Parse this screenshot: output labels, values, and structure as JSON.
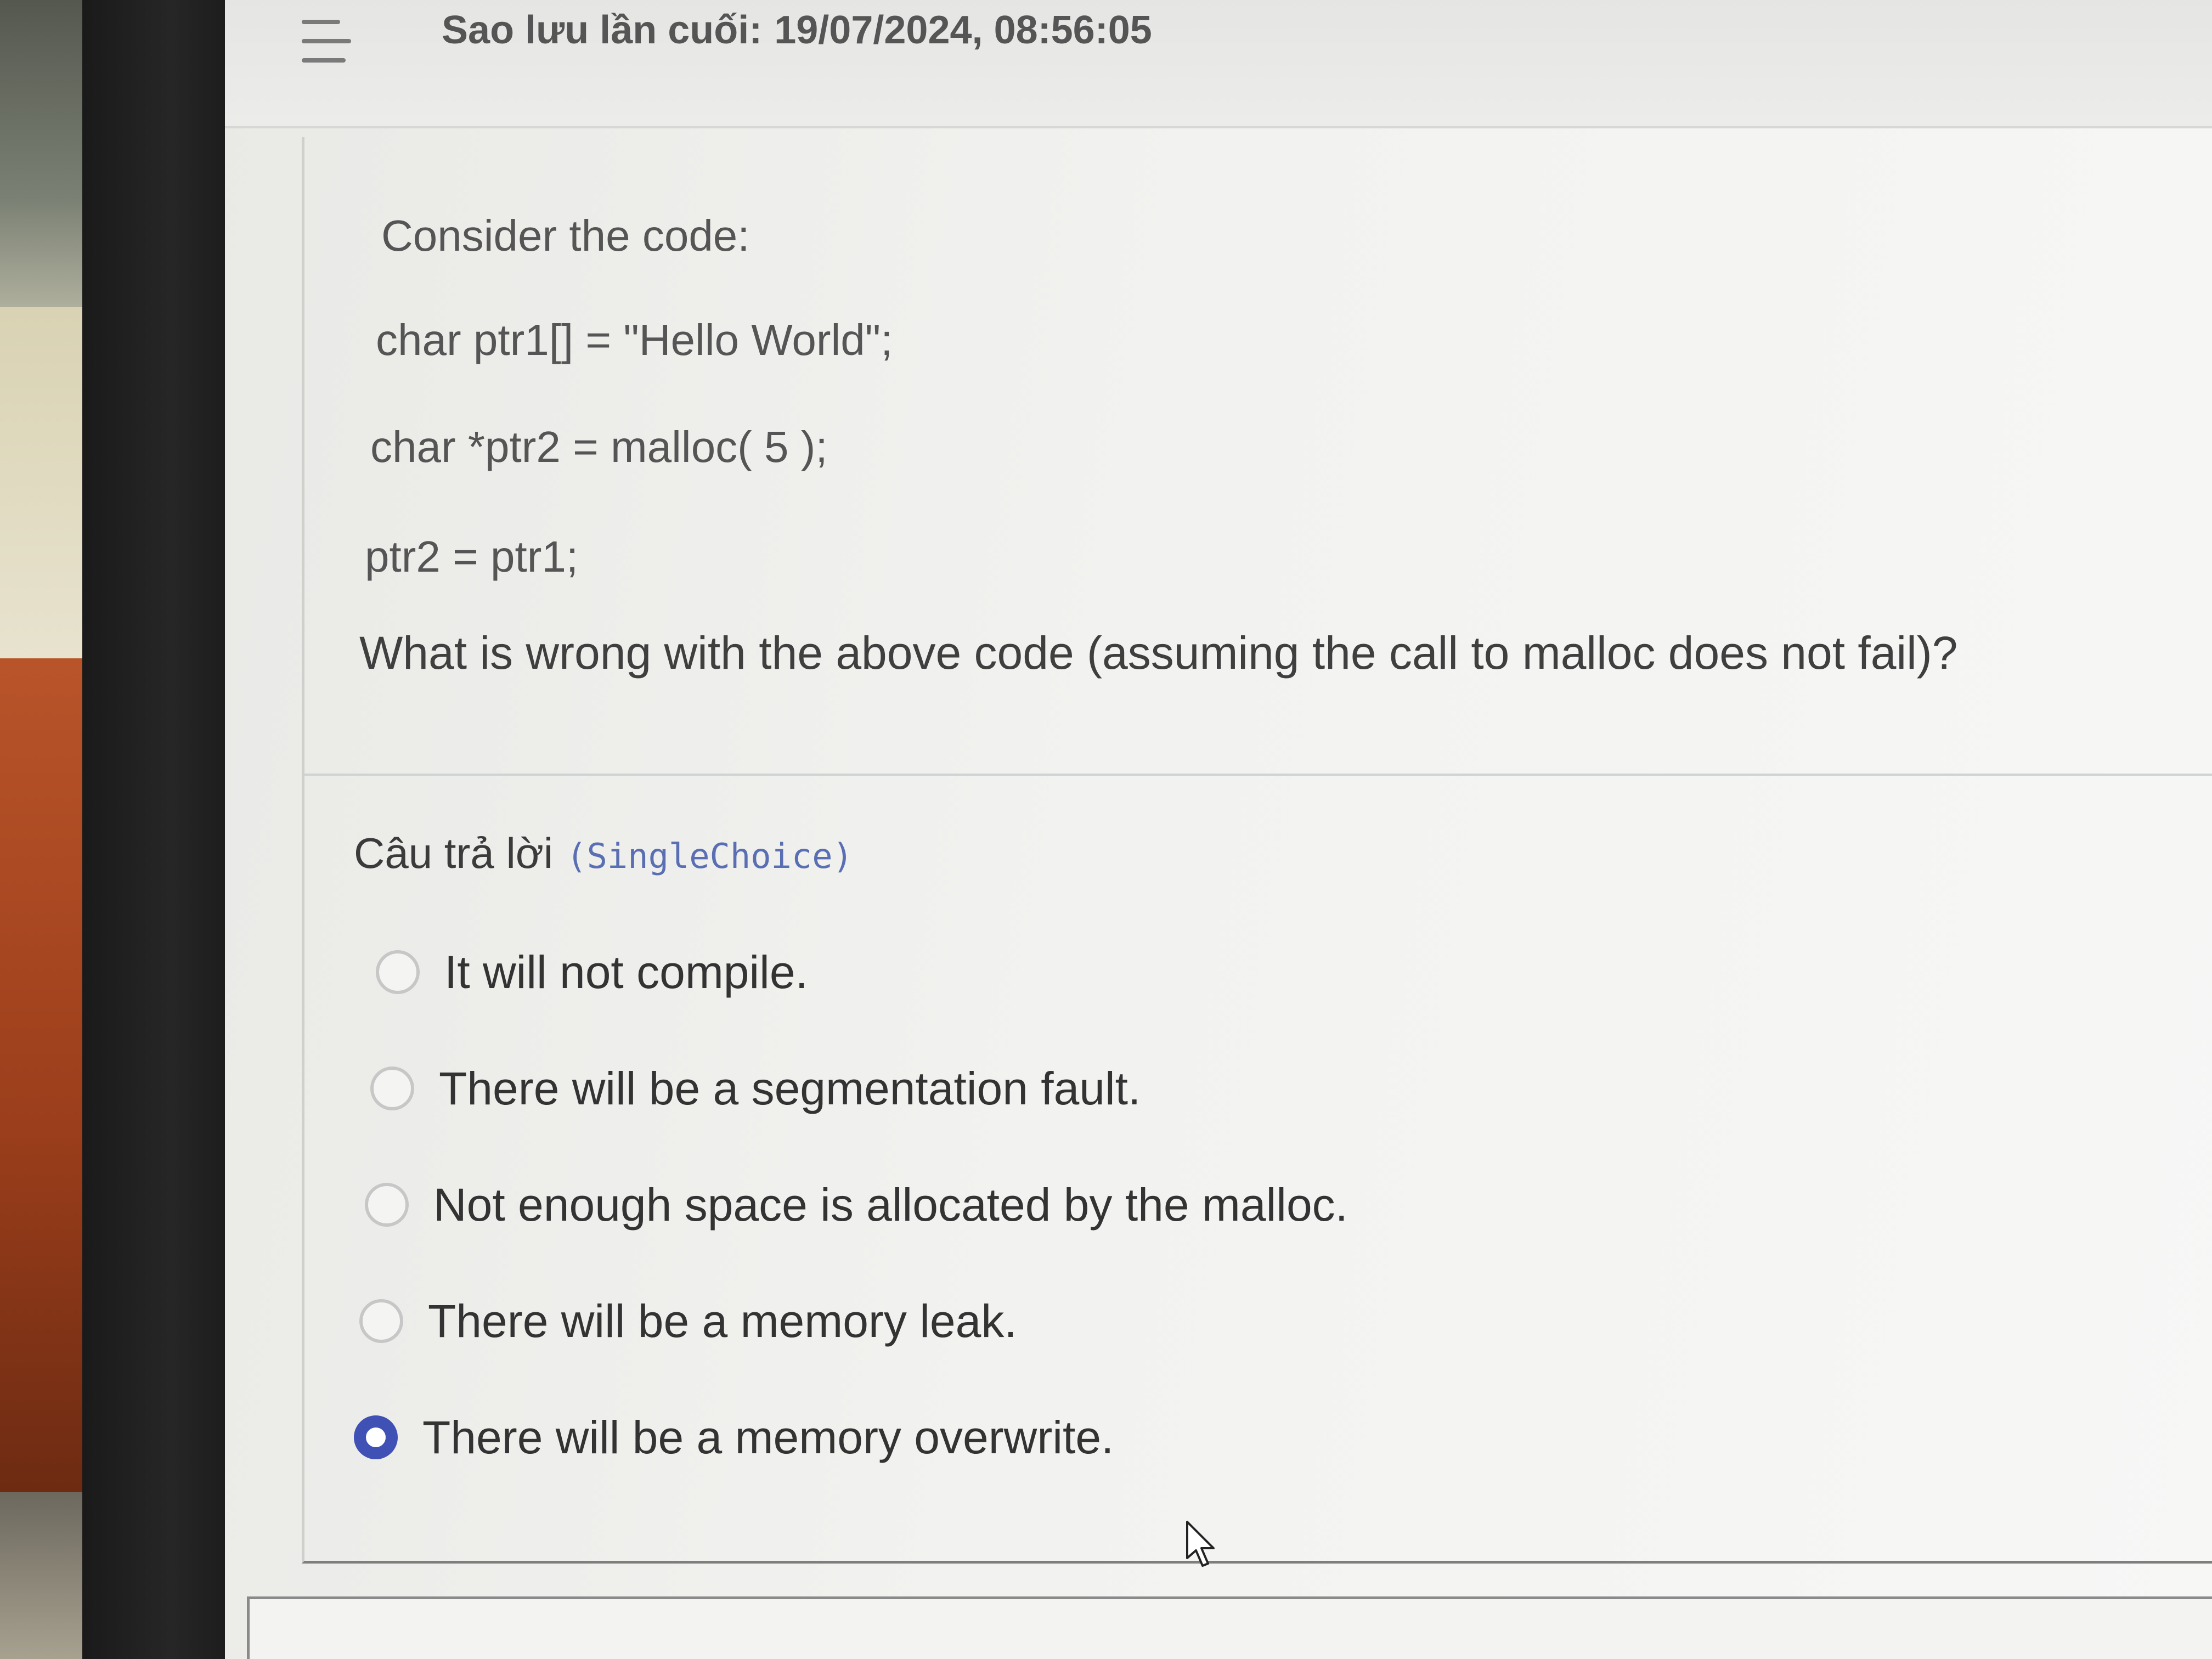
{
  "header": {
    "last_saved_label": "Sao lưu lần cuối:",
    "last_saved_value": "19/07/2024, 08:56:05"
  },
  "question": {
    "intro": "Consider the code:",
    "code_lines": [
      "char ptr1[] = \"Hello World\";",
      "char *ptr2 = malloc( 5 );",
      "ptr2 = ptr1;"
    ],
    "prompt": "What is wrong with the above code (assuming the call to malloc does not fail)?"
  },
  "answers": {
    "heading": "Câu trả lời",
    "type": "(SingleChoice)",
    "options": [
      {
        "label": "It will not compile.",
        "selected": false
      },
      {
        "label": "There will be a segmentation fault.",
        "selected": false
      },
      {
        "label": "Not enough space is allocated by the malloc.",
        "selected": false
      },
      {
        "label": "There will be a memory leak.",
        "selected": false
      },
      {
        "label": "There will be a memory overwrite.",
        "selected": true
      }
    ]
  },
  "colors": {
    "accent": "#3f51b5",
    "text": "#333333"
  },
  "icons": {
    "menu": "hamburger-menu-icon",
    "radio": "radio-button-icon",
    "cursor": "mouse-pointer-icon"
  }
}
